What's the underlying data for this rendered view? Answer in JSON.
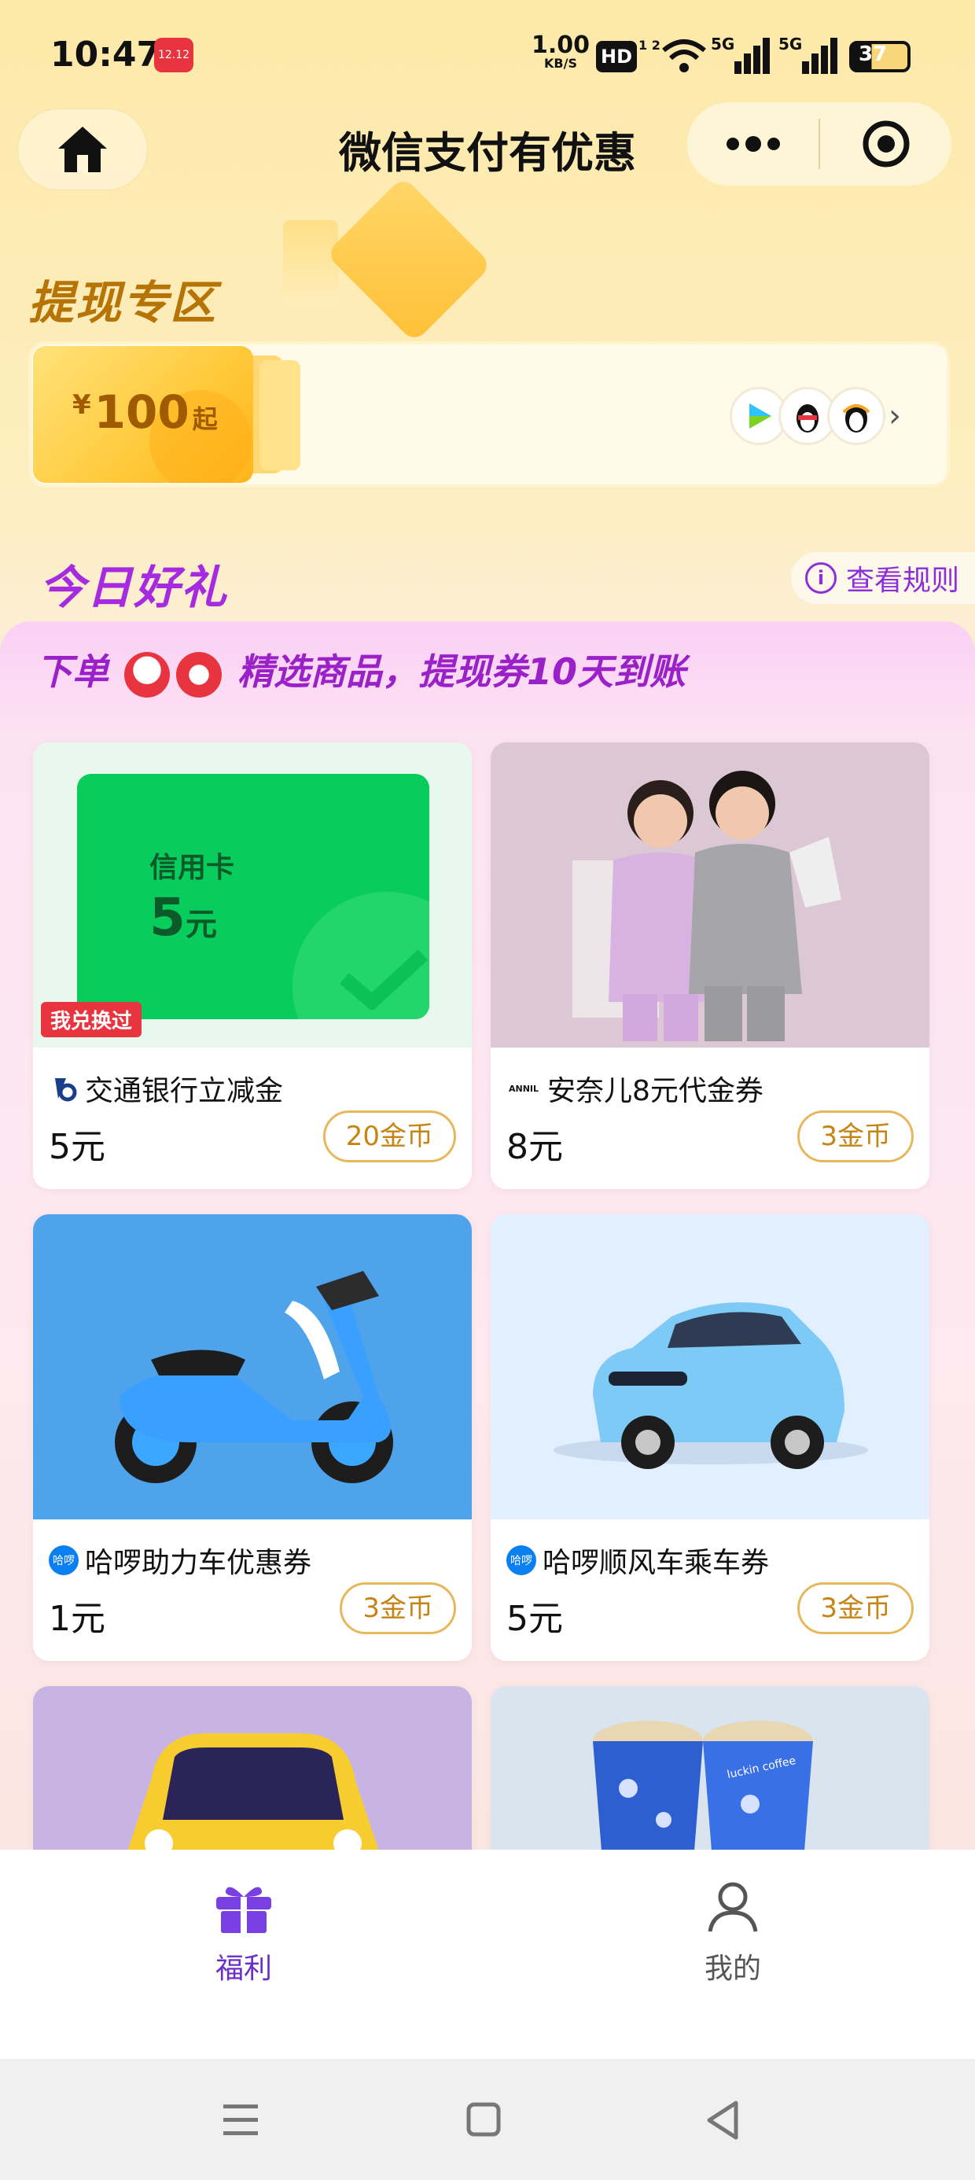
{
  "status_bar": {
    "time": "10:47",
    "mini_badge": "12.12",
    "net_speed_value": "1.00",
    "net_speed_unit": "KB/S",
    "hd_label": "HD",
    "hd_sub": "1 2",
    "signal_1": "5G",
    "signal_2": "5G",
    "battery": "37"
  },
  "nav": {
    "title": "微信支付有优惠",
    "home_icon": "home-icon",
    "more_icon": "more-icon",
    "close_icon": "target-icon"
  },
  "withdraw": {
    "section_title": "提现专区",
    "coupon_currency": "¥",
    "coupon_amount": "100",
    "coupon_suffix": "起",
    "app_icons": [
      "video-play-icon",
      "qq-penguin-icon",
      "qq-penguin-scarf-icon"
    ]
  },
  "gifts": {
    "section_title": "今日好礼",
    "rules_label": "查看规则",
    "promo_prefix": "下单",
    "promo_suffix": "精选商品，提现券10天到账"
  },
  "products": [
    {
      "name": "交通银行立减金",
      "price": "5元",
      "coins": "20金币",
      "tag": "我兑换过",
      "card_line1": "信用卡",
      "card_amount": "5",
      "card_unit": "元",
      "brand_logo": "bocom-logo"
    },
    {
      "name": "安奈儿8元代金券",
      "price": "8元",
      "coins": "3金币",
      "brand_logo": "annil-logo",
      "brand_text": "ANNIL"
    },
    {
      "name": "哈啰助力车优惠券",
      "price": "1元",
      "coins": "3金币",
      "brand_logo": "hello-logo",
      "brand_text": "哈啰"
    },
    {
      "name": "哈啰顺风车乘车券",
      "price": "5元",
      "coins": "3金币",
      "brand_logo": "hello-logo",
      "brand_text": "哈啰"
    },
    {
      "name": "",
      "price": "",
      "coins": ""
    },
    {
      "name": "",
      "price": "",
      "coins": "",
      "cup_text": "luckin coffee"
    }
  ],
  "tabs": [
    {
      "label": "福利",
      "icon": "gift-icon",
      "active": true
    },
    {
      "label": "我的",
      "icon": "profile-icon",
      "active": false
    }
  ],
  "colors": {
    "accent_purple": "#8c2fd9",
    "coin_gold": "#c68415",
    "withdraw_gold": "#b77406"
  }
}
